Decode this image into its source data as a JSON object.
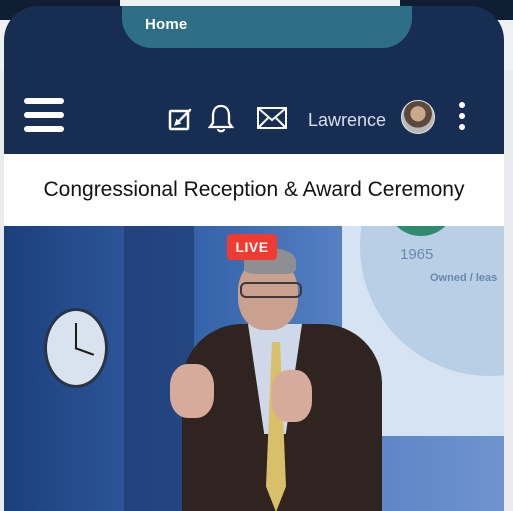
{
  "app": {
    "tab_label": "Home"
  },
  "header": {
    "user_name": "Lawrence",
    "icons": [
      "menu-icon",
      "edit-icon",
      "bell-icon",
      "mail-icon",
      "avatar",
      "more-icon"
    ]
  },
  "event": {
    "title": "Congressional Reception & Award Ceremony",
    "status_badge": "LIVE"
  },
  "video_overlay_text": {
    "year": "1965",
    "caption": "Owned / leas"
  },
  "colors": {
    "header_bg": "#182d52",
    "tab_bg": "#2f6f85",
    "live_red": "#ef3b30"
  }
}
